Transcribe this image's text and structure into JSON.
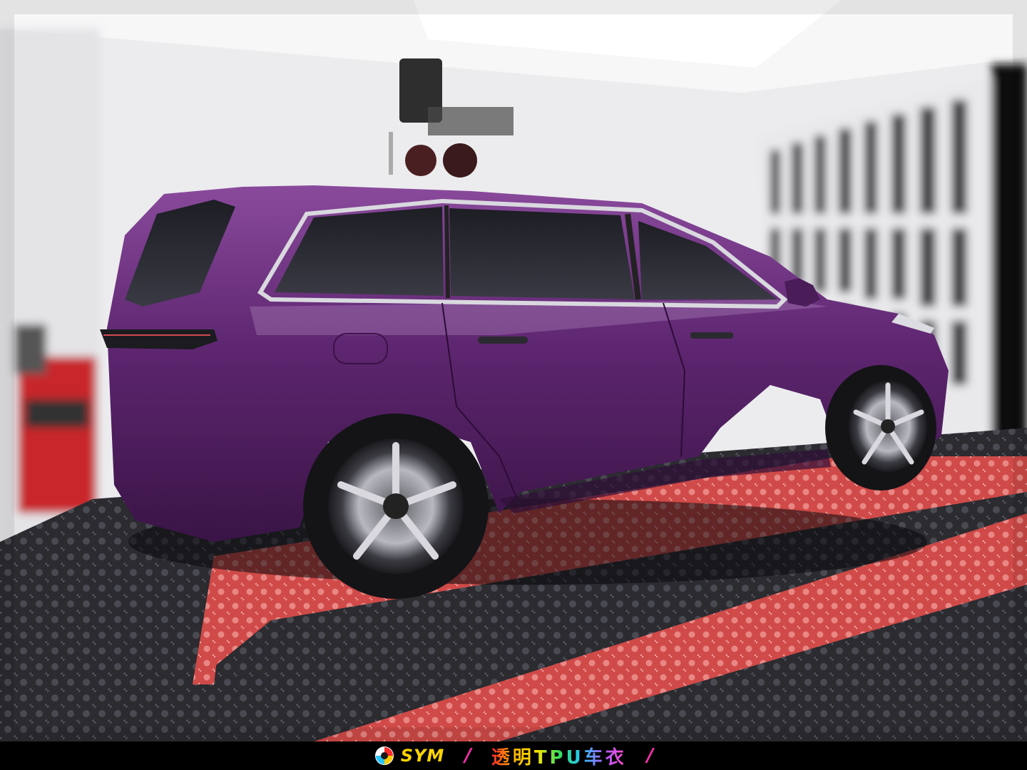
{
  "banner": {
    "brand": "SYM",
    "separator_left": "/",
    "tagline": "透明TPU车衣",
    "separator_right": "/",
    "logo_icon": "sym-swirl-logo-icon"
  },
  "colors": {
    "car_body": "#5a2468",
    "floor_red": "#d9534f",
    "floor_black": "#2a2a2e",
    "wall": "#f2f2f2",
    "brand_yellow": "#ffd400",
    "slash_pink": "#ff2fae"
  }
}
